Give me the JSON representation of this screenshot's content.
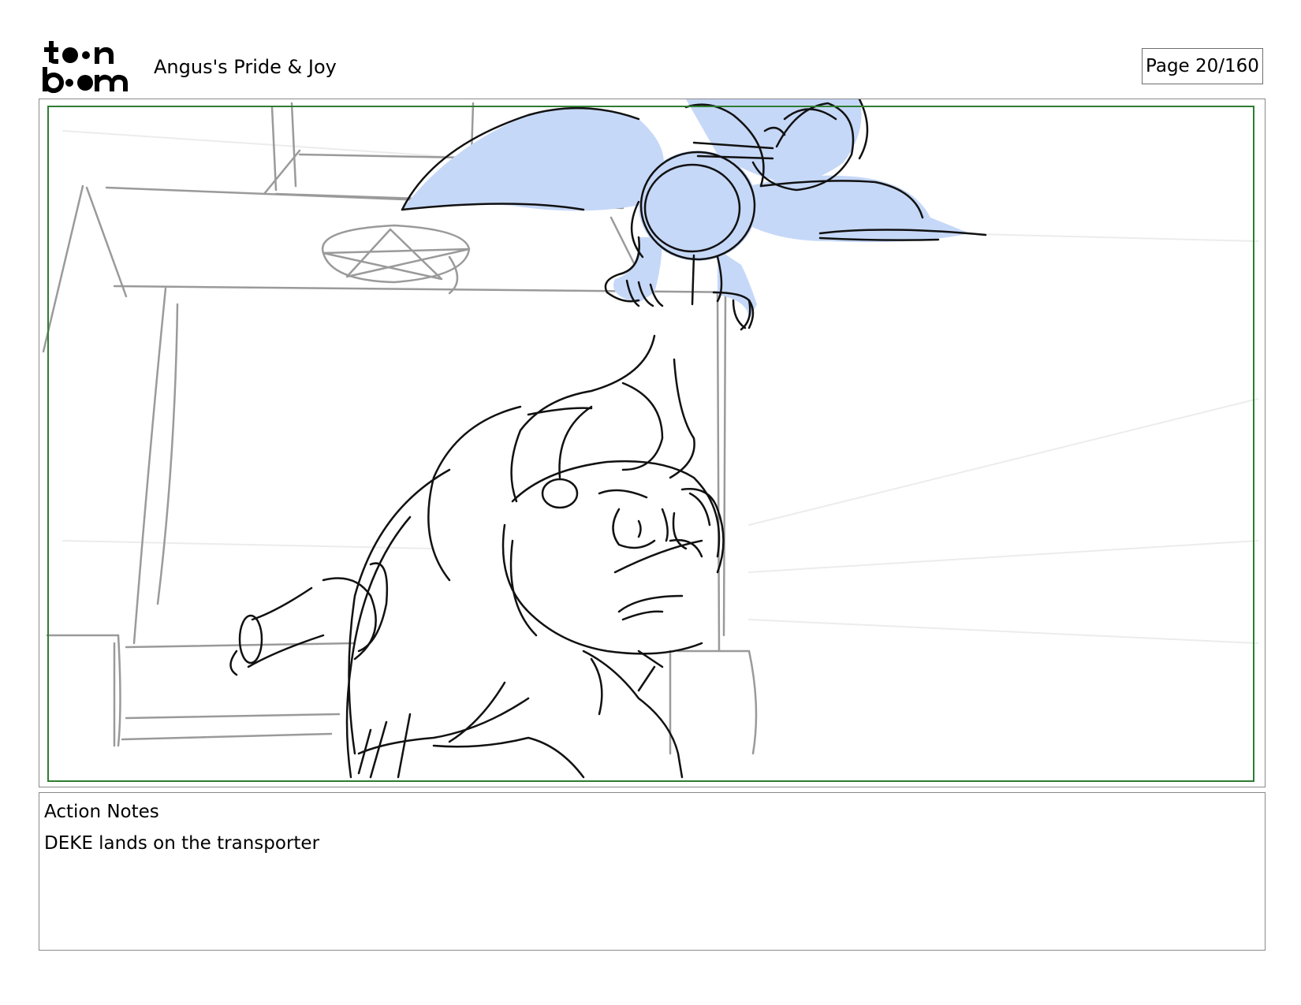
{
  "header": {
    "logo_line1": "toon",
    "logo_line2": "boom",
    "project_title": "Angus's Pride & Joy",
    "page_label": "Page  20/160"
  },
  "panel": {
    "safe_area_color": "#2e7d32",
    "wing_fill_color": "#c6d8f8",
    "background_line_color": "#9a9a9a",
    "character_line_color": "#111111"
  },
  "notes": {
    "heading": "Action Notes",
    "text": "DEKE lands on the transporter"
  }
}
